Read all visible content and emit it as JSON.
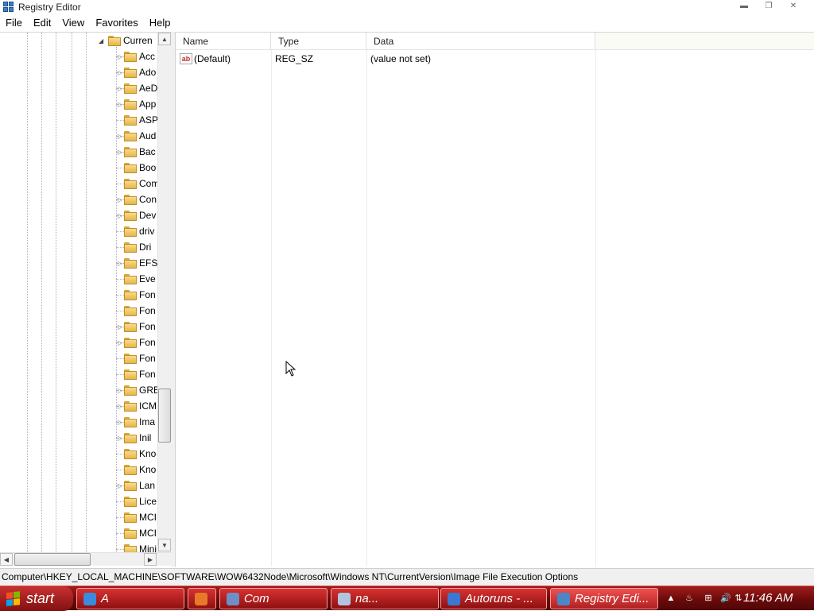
{
  "window": {
    "title": "Registry Editor",
    "minimize_glyph": "▬",
    "maximize_glyph": "❐",
    "close_glyph": "✕"
  },
  "menu": [
    "File",
    "Edit",
    "View",
    "Favorites",
    "Help"
  ],
  "tree": {
    "expanded_node": {
      "label": "Curren",
      "expander": "◢"
    },
    "children": [
      {
        "label": "Acc",
        "expander": "▷"
      },
      {
        "label": "Ado",
        "expander": "▷"
      },
      {
        "label": "AeD",
        "expander": "▷"
      },
      {
        "label": "App",
        "expander": "▷"
      },
      {
        "label": "ASP",
        "expander": ""
      },
      {
        "label": "Aud",
        "expander": "▷"
      },
      {
        "label": "Bac",
        "expander": "▷"
      },
      {
        "label": "Boo",
        "expander": ""
      },
      {
        "label": "Com",
        "expander": ""
      },
      {
        "label": "Con",
        "expander": "▷"
      },
      {
        "label": "Dev",
        "expander": "▷"
      },
      {
        "label": "driv",
        "expander": ""
      },
      {
        "label": "Dri",
        "expander": ""
      },
      {
        "label": "EFS",
        "expander": "▷"
      },
      {
        "label": "Eve",
        "expander": ""
      },
      {
        "label": "Fon",
        "expander": ""
      },
      {
        "label": "Fon",
        "expander": ""
      },
      {
        "label": "Fon",
        "expander": "▷"
      },
      {
        "label": "Fon",
        "expander": "▷"
      },
      {
        "label": "Fon",
        "expander": ""
      },
      {
        "label": "Fon",
        "expander": ""
      },
      {
        "label": "GRE",
        "expander": "▷"
      },
      {
        "label": "ICM",
        "expander": "▷"
      },
      {
        "label": "Ima",
        "expander": "▷"
      },
      {
        "label": "Inil",
        "expander": "▷"
      },
      {
        "label": "Kno",
        "expander": ""
      },
      {
        "label": "Kno",
        "expander": ""
      },
      {
        "label": "Lan",
        "expander": "▷"
      },
      {
        "label": "Lice",
        "expander": ""
      },
      {
        "label": "MCI",
        "expander": ""
      },
      {
        "label": "MCI",
        "expander": ""
      },
      {
        "label": "Mini",
        "expander": ""
      }
    ],
    "scroll_up_glyph": "▲",
    "scroll_down_glyph": "▼",
    "scroll_left_glyph": "◀",
    "scroll_right_glyph": "▶"
  },
  "list": {
    "columns": [
      "Name",
      "Type",
      "Data"
    ],
    "rows": [
      {
        "icon": "string-value-icon",
        "icon_text": "ab",
        "name": "(Default)",
        "type": "REG_SZ",
        "data": "(value not set)"
      }
    ]
  },
  "status_bar": {
    "path": "Computer\\HKEY_LOCAL_MACHINE\\SOFTWARE\\WOW6432Node\\Microsoft\\Windows NT\\CurrentVersion\\Image File Execution Options"
  },
  "taskbar": {
    "start_label": "start",
    "buttons": [
      {
        "label": "A",
        "icon": "chrome-icon",
        "icon_color": "#3a8be0"
      },
      {
        "label": "",
        "icon": "firefox-icon",
        "icon_color": "#e8792b"
      },
      {
        "label": "Com",
        "icon": "computer-icon",
        "icon_color": "#6e8fc5"
      },
      {
        "label": "na...",
        "icon": "task-manager-icon",
        "icon_color": "#b0c4de"
      },
      {
        "label": "Autoruns - ...",
        "icon": "autoruns-icon",
        "icon_color": "#3b78d1"
      },
      {
        "label": "Registry Edi...",
        "icon": "registry-editor-icon",
        "icon_color": "#4a86c8"
      }
    ],
    "tray": [
      {
        "name": "show-hidden-icons-icon",
        "glyph": "▲"
      },
      {
        "name": "java-update-icon",
        "glyph": "♨"
      },
      {
        "name": "network-icon",
        "glyph": "⊞"
      },
      {
        "name": "volume-icon",
        "glyph": "🔊"
      },
      {
        "name": "safely-remove-icon",
        "glyph": "⇅"
      }
    ],
    "clock": "11:46 AM"
  },
  "colors": {
    "taskbar": "#7a0c0c",
    "task_button": "#c42424",
    "folder": "#f0c860"
  }
}
